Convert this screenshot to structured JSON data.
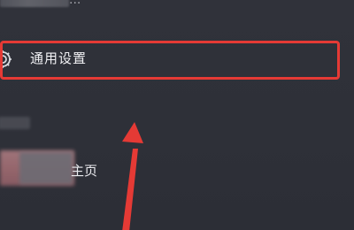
{
  "top_row": {
    "tail_text": "..."
  },
  "settings": {
    "label": "通用设置",
    "icon": "gear-icon"
  },
  "home": {
    "label_partial": "主页"
  },
  "annotation": {
    "highlight_color": "#e53a35",
    "arrow_color": "#e53a35"
  }
}
